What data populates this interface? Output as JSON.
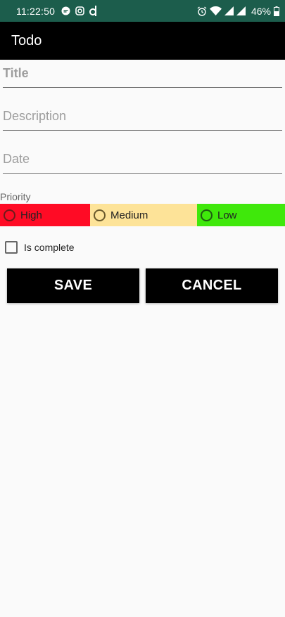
{
  "status_bar": {
    "time": "11:22:50",
    "battery": "46%",
    "left_icons": [
      "chat-bubble-icon",
      "instagram-icon",
      "d-app-icon"
    ],
    "right_icons": [
      "alarm-icon",
      "wifi-icon",
      "signal-icon",
      "signal-icon",
      "battery-icon"
    ]
  },
  "app_bar": {
    "title": "Todo"
  },
  "form": {
    "title_placeholder": "Title",
    "description_placeholder": "Description",
    "date_placeholder": "Date",
    "priority_label": "Priority",
    "priorities": [
      {
        "label": "High",
        "color": "#ff0b25"
      },
      {
        "label": "Medium",
        "color": "#fde398"
      },
      {
        "label": "Low",
        "color": "#3fe80b"
      }
    ],
    "complete_label": "Is complete",
    "complete_checked": false
  },
  "actions": {
    "save": "SAVE",
    "cancel": "CANCEL"
  }
}
